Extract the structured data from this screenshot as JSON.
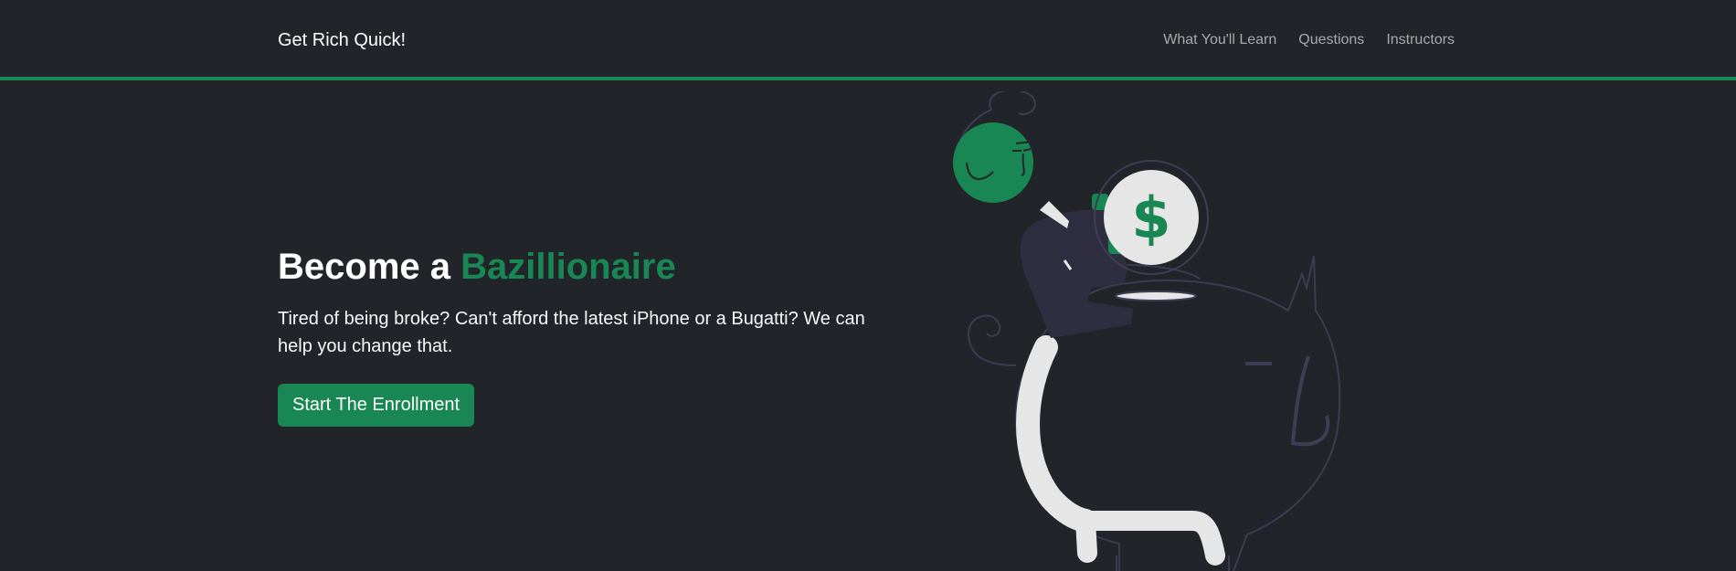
{
  "navbar": {
    "brand": "Get Rich Quick!",
    "links": [
      "What You'll Learn",
      "Questions",
      "Instructors"
    ]
  },
  "hero": {
    "title_prefix": "Become a",
    "title_accent": "Bazillionaire",
    "lead": "Tired of being broke? Can't afford the latest iPhone or a Bugatti? We can help you change that.",
    "cta_label": "Start The Enrollment",
    "coin_symbol": "$"
  },
  "colors": {
    "background": "#212529",
    "accent": "#198754",
    "text": "#ffffff",
    "nav_text_muted": "rgba(255,255,255,0.6)"
  }
}
